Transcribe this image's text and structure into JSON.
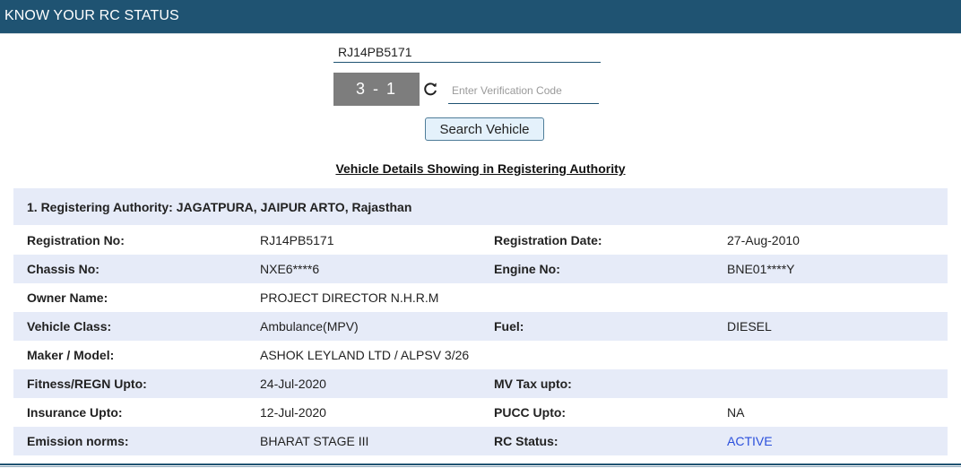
{
  "header": {
    "title": "KNOW YOUR RC STATUS"
  },
  "search": {
    "registration_value": "RJ14PB5171",
    "captcha_text": "3 - 1",
    "verification_placeholder": "Enter Verification Code",
    "search_button_label": "Search Vehicle"
  },
  "results": {
    "heading": "Vehicle Details Showing in Registering Authority",
    "authority": "1. Registering Authority: JAGATPURA, JAIPUR ARTO, Rajasthan",
    "rows": [
      {
        "l1": "Registration No:",
        "v1": "RJ14PB5171",
        "l2": "Registration Date:",
        "v2": "27-Aug-2010"
      },
      {
        "l1": "Chassis No:",
        "v1": "NXE6****6",
        "l2": "Engine No:",
        "v2": "BNE01****Y"
      },
      {
        "l1": "Owner Name:",
        "v1": "PROJECT DIRECTOR N.H.R.M",
        "l2": "",
        "v2": ""
      },
      {
        "l1": "Vehicle Class:",
        "v1": "Ambulance(MPV)",
        "l2": "Fuel:",
        "v2": "DIESEL"
      },
      {
        "l1": "Maker / Model:",
        "v1": "ASHOK LEYLAND LTD / ALPSV 3/26",
        "l2": "",
        "v2": ""
      },
      {
        "l1": "Fitness/REGN Upto:",
        "v1": "24-Jul-2020",
        "l2": "MV Tax upto:",
        "v2": ""
      },
      {
        "l1": "Insurance Upto:",
        "v1": "12-Jul-2020",
        "l2": "PUCC Upto:",
        "v2": "NA"
      },
      {
        "l1": "Emission norms:",
        "v1": "BHARAT STAGE III",
        "l2": "RC Status:",
        "v2": "ACTIVE"
      }
    ]
  },
  "colors": {
    "header_bg": "#1f5372",
    "alt_row_bg": "#e6ebf8",
    "status_active": "#2a4fdc"
  },
  "icons": {
    "refresh": "refresh-icon"
  }
}
